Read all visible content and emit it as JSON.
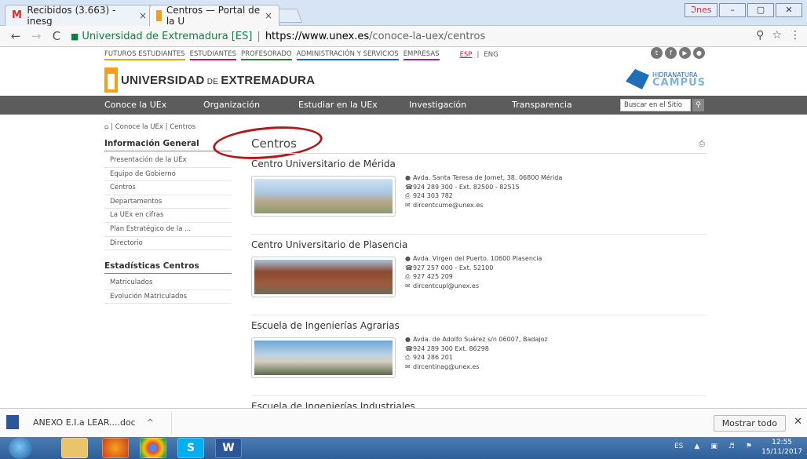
{
  "browser": {
    "tabs": [
      {
        "label": "Recibidos (3.663) - inesg",
        "close": "×"
      },
      {
        "label": "Centros — Portal de la U",
        "close": "×"
      }
    ],
    "window_user": "ℑnes",
    "window_controls": [
      "–",
      "▢",
      "✕"
    ],
    "address": {
      "secure_label": "Universidad de Extremadura [ES]",
      "url_host": "https://www.unex.es",
      "url_path": "/conoce-la-uex/centros"
    },
    "nav": {
      "back": "←",
      "forward": "→",
      "reload": "C"
    },
    "actions": {
      "zoom": "⚲",
      "star": "☆",
      "menu": "⋮"
    }
  },
  "site": {
    "topnav": [
      {
        "label": "FUTUROS ESTUDIANTES",
        "color": "#e8a317"
      },
      {
        "label": "ESTUDIANTES",
        "color": "#c2185b"
      },
      {
        "label": "PROFESORADO",
        "color": "#2e7d32"
      },
      {
        "label": "ADMINISTRACIÓN Y SERVICIOS",
        "color": "#1565c0"
      },
      {
        "label": "EMPRESAS",
        "color": "#8e24aa"
      }
    ],
    "lang": {
      "esp": "ESP",
      "sep": "|",
      "eng": "ENG"
    },
    "logo": {
      "text_a": "UNIVERSIDAD",
      "text_de": " DE ",
      "text_b": "EXTREMADURA"
    },
    "hidra": {
      "line1": "HIDRANATURA",
      "line2": "CAMPUS"
    },
    "mainnav": [
      "Conoce la UEx",
      "Organización",
      "Estudiar en la UEx",
      "Investigación",
      "Transparencia"
    ],
    "search_placeholder": "Buscar en el Sitio",
    "breadcrumb": {
      "home": "⌂",
      "items": [
        "Conoce la UEx",
        "Centros"
      ],
      "sep": "|"
    },
    "sidebar": {
      "heading1": "Información General",
      "items1": [
        "Presentación de la UEx",
        "Equipo de Gobierno",
        "Centros",
        "Departamentos",
        "La UEx en cifras",
        "Plan Estratégico de la ...",
        "Directorio"
      ],
      "heading2": "Estadísticas Centros",
      "items2": [
        "Matriculados",
        "Evolución Matriculados"
      ]
    },
    "content": {
      "title": "Centros",
      "centers": [
        {
          "name": "Centro Universitario de Mérida",
          "address": "Avda. Santa Teresa de Jornet, 38. 06800 Mérida",
          "phone": "924 289 300 - Ext. 82500 - 82515",
          "fax": "924 303 782",
          "email": "dircentcume@unex.es"
        },
        {
          "name": "Centro Universitario de Plasencia",
          "address": "Avda. Virgen del Puerto. 10600 Plasencia",
          "phone": "927 257 000 - Ext. 52100",
          "fax": "927 425 209",
          "email": "dircentcupl@unex.es"
        },
        {
          "name": "Escuela de Ingenierías Agrarias",
          "address": "Avda. de Adolfo Suárez s/n 06007, Badajoz",
          "phone": "924 289 300 Ext. 86298",
          "fax": "924 286 201",
          "email": "dircentinag@unex.es"
        },
        {
          "name": "Escuela de Ingenierías Industriales"
        }
      ]
    }
  },
  "downloads": {
    "file": "ANEXO E.I.a LEAR....doc",
    "caret": "^",
    "show_all": "Mostrar todo",
    "close": "✕"
  },
  "taskbar": {
    "apps": [
      "",
      "",
      "",
      "S",
      "W"
    ],
    "lang": "ES",
    "time": "12:55",
    "date": "15/11/2017"
  }
}
